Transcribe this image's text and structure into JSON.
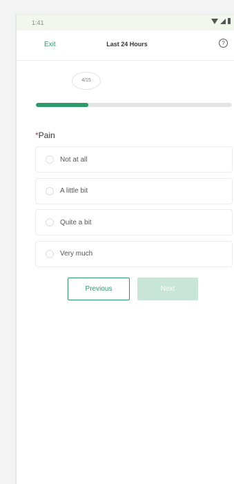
{
  "status_bar": {
    "time": "1:41",
    "icons": [
      "wifi-icon",
      "signal-icon",
      "battery-icon"
    ]
  },
  "header": {
    "exit_label": "Exit",
    "title": "Last 24 Hours",
    "help_icon": "help-circle-icon",
    "help_glyph": "?"
  },
  "progress": {
    "label": "4/15",
    "current": 4,
    "total": 15
  },
  "question": {
    "required_mark": "*",
    "label": "Pain",
    "options": [
      {
        "label": "Not at all",
        "selected": false
      },
      {
        "label": "A little bit",
        "selected": false
      },
      {
        "label": "Quite a bit",
        "selected": false
      },
      {
        "label": "Very much",
        "selected": false
      }
    ]
  },
  "navigation": {
    "previous_label": "Previous",
    "next_label": "Next",
    "next_enabled": false
  },
  "colors": {
    "accent": "#2e9a6b",
    "accent_disabled": "#c7e6d7",
    "required": "#d0312d"
  }
}
